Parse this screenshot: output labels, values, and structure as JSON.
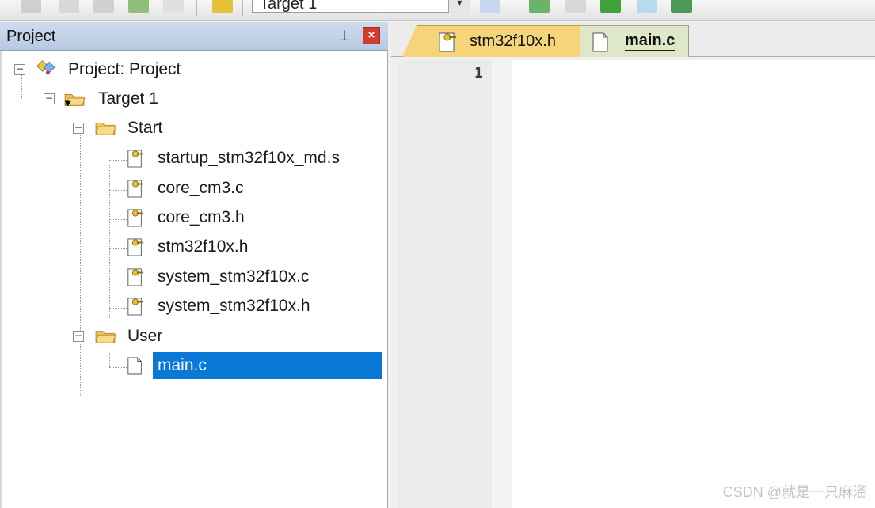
{
  "toolbar": {
    "target_value": "Target 1",
    "icons": [
      "build-icon",
      "rebuild-icon",
      "batch-build-icon",
      "stack-icon",
      "translate-icon",
      "download-icon",
      "target-options-icon",
      "manage-components-icon",
      "pack-installer-icon",
      "select-software-packs-icon",
      "run-env-icon"
    ]
  },
  "project_pane": {
    "title": "Project",
    "pin_icon": "pin-icon",
    "close_label": "×",
    "tree": {
      "root": "Project: Project",
      "target": "Target 1",
      "groups": [
        {
          "name": "Start",
          "files": [
            "startup_stm32f10x_md.s",
            "core_cm3.c",
            "core_cm3.h",
            "stm32f10x.h",
            "system_stm32f10x.c",
            "system_stm32f10x.h"
          ]
        },
        {
          "name": "User",
          "files": [
            "main.c"
          ]
        }
      ]
    }
  },
  "editor": {
    "tabs": [
      {
        "label": "stm32f10x.h",
        "active": false
      },
      {
        "label": "main.c",
        "active": true
      }
    ],
    "line_numbers": [
      "1"
    ]
  },
  "watermark": "CSDN @就是一只麻溜",
  "colors": {
    "selection": "#0a78d7",
    "tab_header": "#f5d47a",
    "tab_active": "#dfe7c9",
    "close_red": "#d33b2e"
  }
}
